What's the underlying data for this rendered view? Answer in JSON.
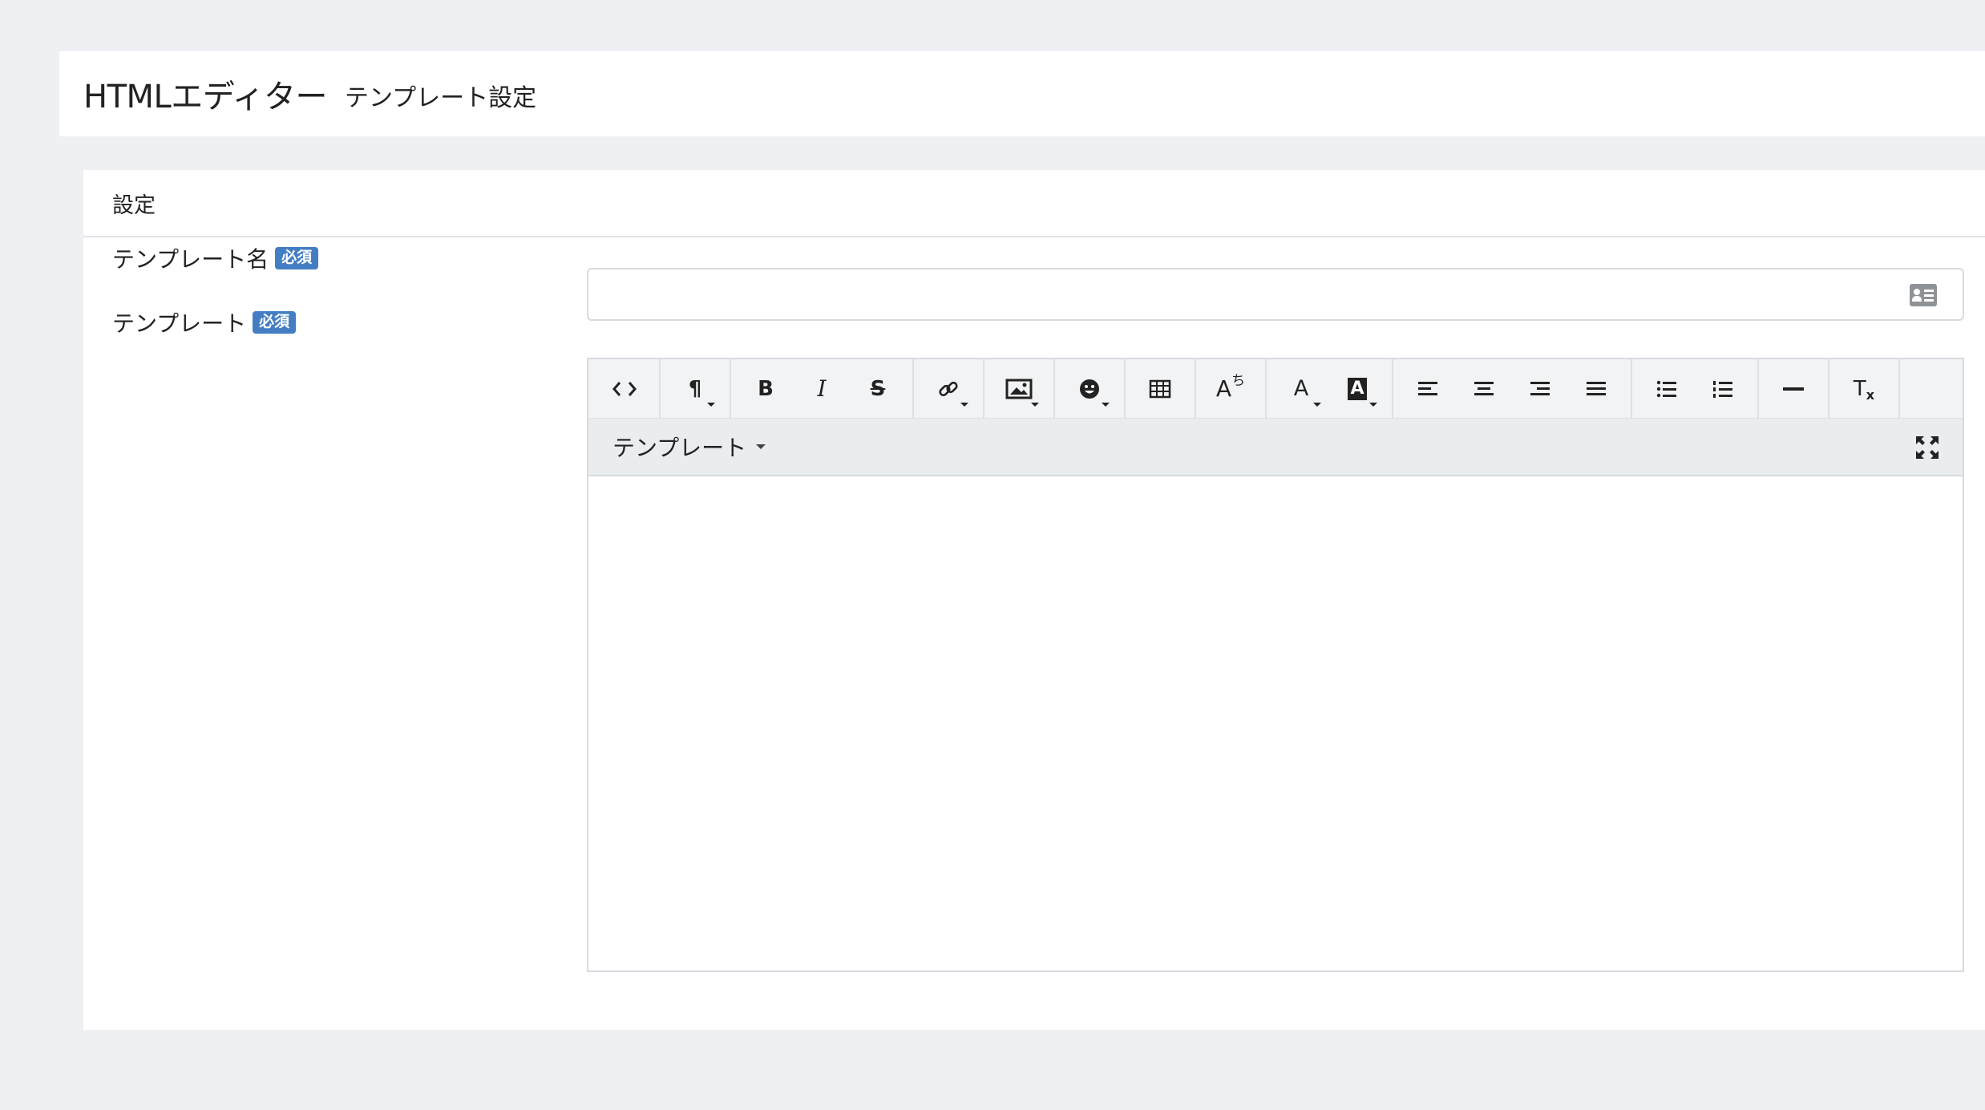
{
  "header": {
    "title": "HTMLエディター",
    "subtitle": "テンプレート設定"
  },
  "card": {
    "title": "設定"
  },
  "form": {
    "template_name_label": "テンプレート名",
    "template_label": "テンプレート",
    "required_badge": "必須",
    "template_name_value": ""
  },
  "editor": {
    "toolbar": [
      {
        "name": "code-view",
        "icon": "code-icon"
      },
      {
        "name": "paragraph-style",
        "icon": "paragraph-icon",
        "has_dropdown": true
      },
      {
        "name": "bold",
        "icon": "bold-icon"
      },
      {
        "name": "italic",
        "icon": "italic-icon"
      },
      {
        "name": "strikethrough",
        "icon": "strikethrough-icon"
      },
      {
        "name": "link",
        "icon": "link-icon",
        "has_dropdown": true
      },
      {
        "name": "image",
        "icon": "image-icon",
        "has_dropdown": true
      },
      {
        "name": "emoji",
        "icon": "emoji-icon",
        "has_dropdown": true
      },
      {
        "name": "table",
        "icon": "table-icon"
      },
      {
        "name": "ruby",
        "icon": "ruby-icon"
      },
      {
        "name": "font-color",
        "icon": "font-color-icon",
        "has_dropdown": true
      },
      {
        "name": "highlight-color",
        "icon": "highlight-icon",
        "has_dropdown": true
      },
      {
        "name": "align-left",
        "icon": "align-left-icon"
      },
      {
        "name": "align-center",
        "icon": "align-center-icon"
      },
      {
        "name": "align-right",
        "icon": "align-right-icon"
      },
      {
        "name": "align-justify",
        "icon": "align-justify-icon"
      },
      {
        "name": "unordered-list",
        "icon": "bullet-list-icon"
      },
      {
        "name": "ordered-list",
        "icon": "numbered-list-icon"
      },
      {
        "name": "horizontal-rule",
        "icon": "horizontal-rule-icon"
      },
      {
        "name": "clear-format",
        "icon": "clear-format-icon"
      }
    ],
    "template_menu_label": "テンプレート",
    "content": ""
  },
  "colors": {
    "background": "#eef0f4",
    "badge": "#437ec4",
    "toolbar": "#f2f3f4"
  }
}
